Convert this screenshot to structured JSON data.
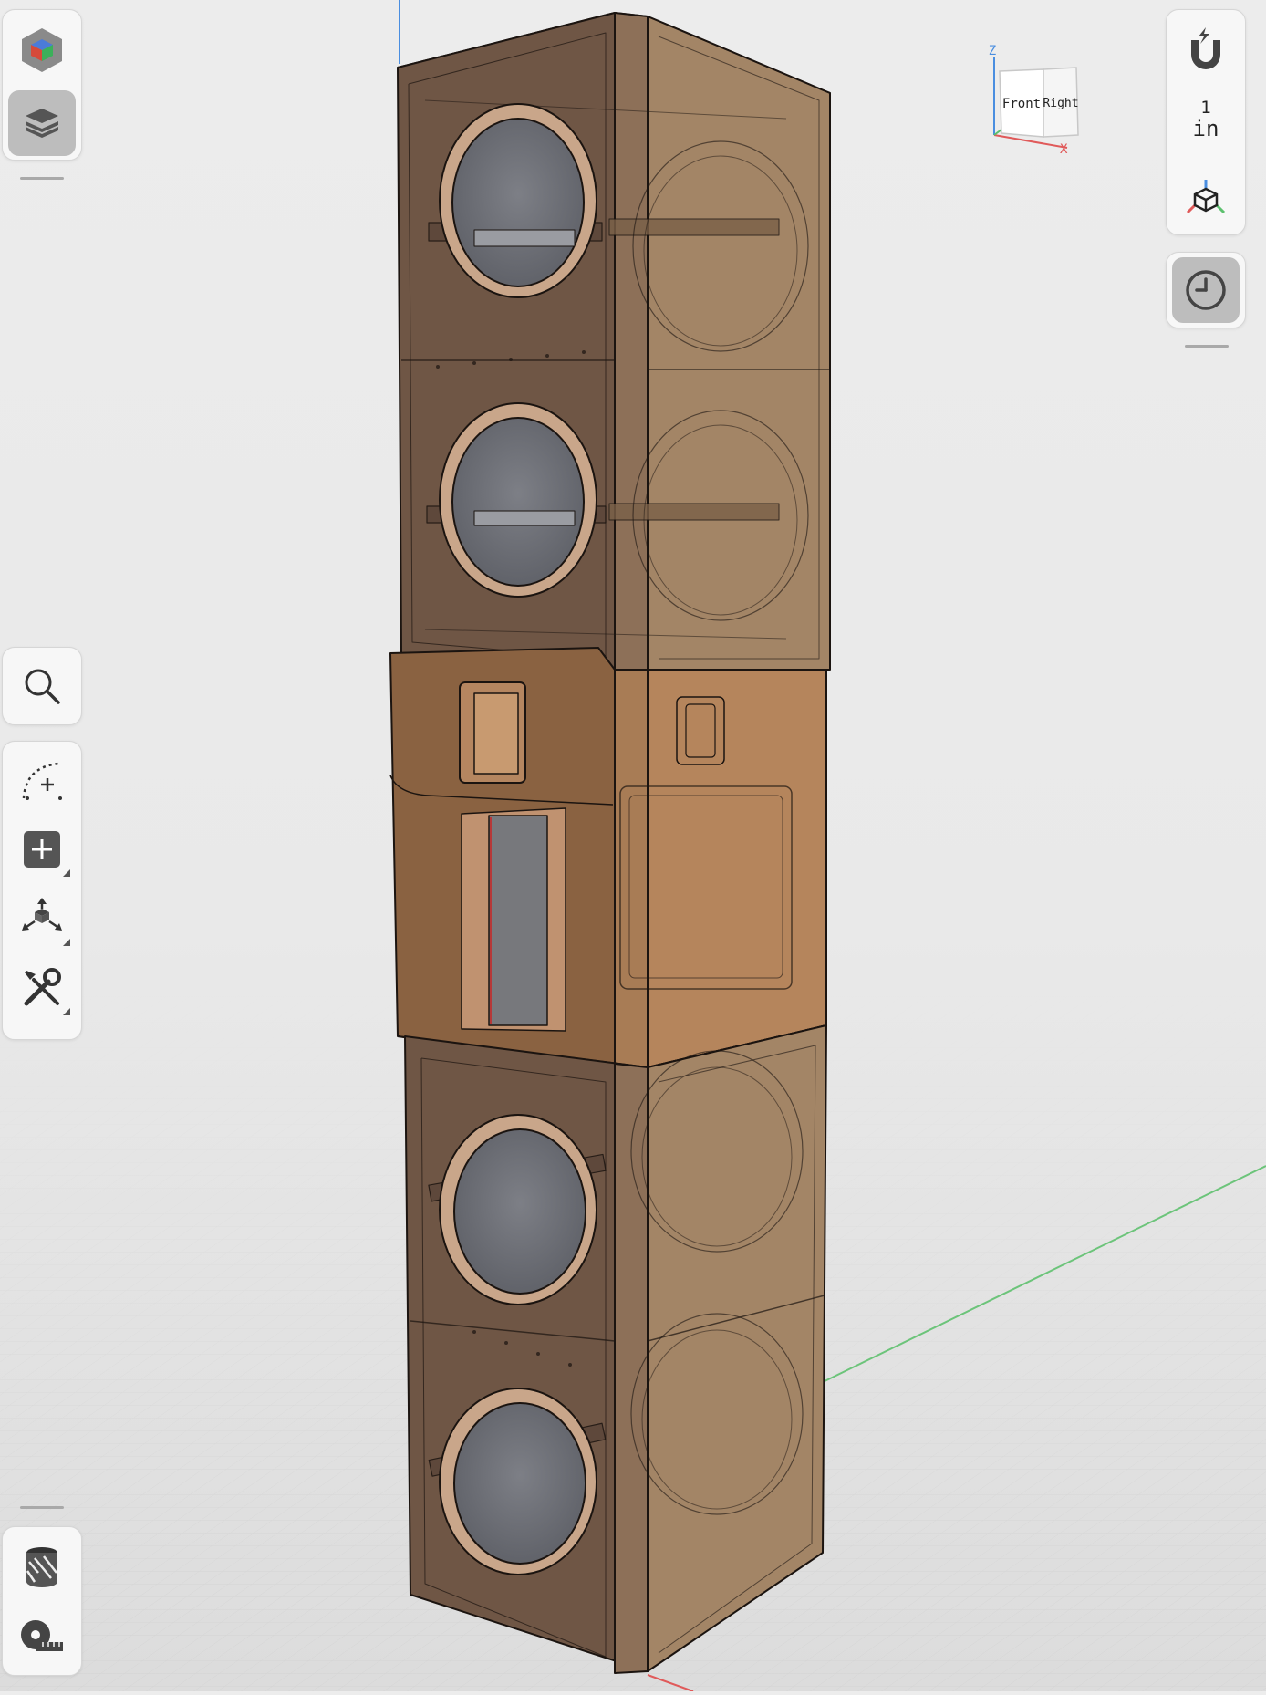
{
  "view_cube": {
    "front_label": "Front",
    "right_label": "Right",
    "z_axis_label": "Z",
    "x_axis_label": "X"
  },
  "right_toolbar": {
    "scale_value": "1",
    "scale_unit": "in"
  },
  "icons": {
    "top_left": [
      "model-cube-icon",
      "layers-icon"
    ],
    "left_middle": [
      "search-icon"
    ],
    "left_tools": [
      "sketch-curve-icon",
      "add-icon",
      "transform-icon",
      "tools-icon"
    ],
    "bottom_left": [
      "appearance-icon",
      "measure-tape-icon"
    ],
    "right_top": [
      "snap-magnet-icon",
      "view-orientation-icon"
    ],
    "right_bottom": [
      "history-clock-icon"
    ]
  },
  "colors": {
    "background": "#ededed",
    "panel": "#f7f7f7",
    "active_tool": "#bdbdbd",
    "model_dark": "#6d5544",
    "model_light": "#a9876a",
    "model_middle": "#b07a4e",
    "speaker_cone": "#6f7178",
    "axis_z": "#4a8ee0",
    "axis_y": "#5cc06e",
    "axis_x": "#e05a5a"
  }
}
